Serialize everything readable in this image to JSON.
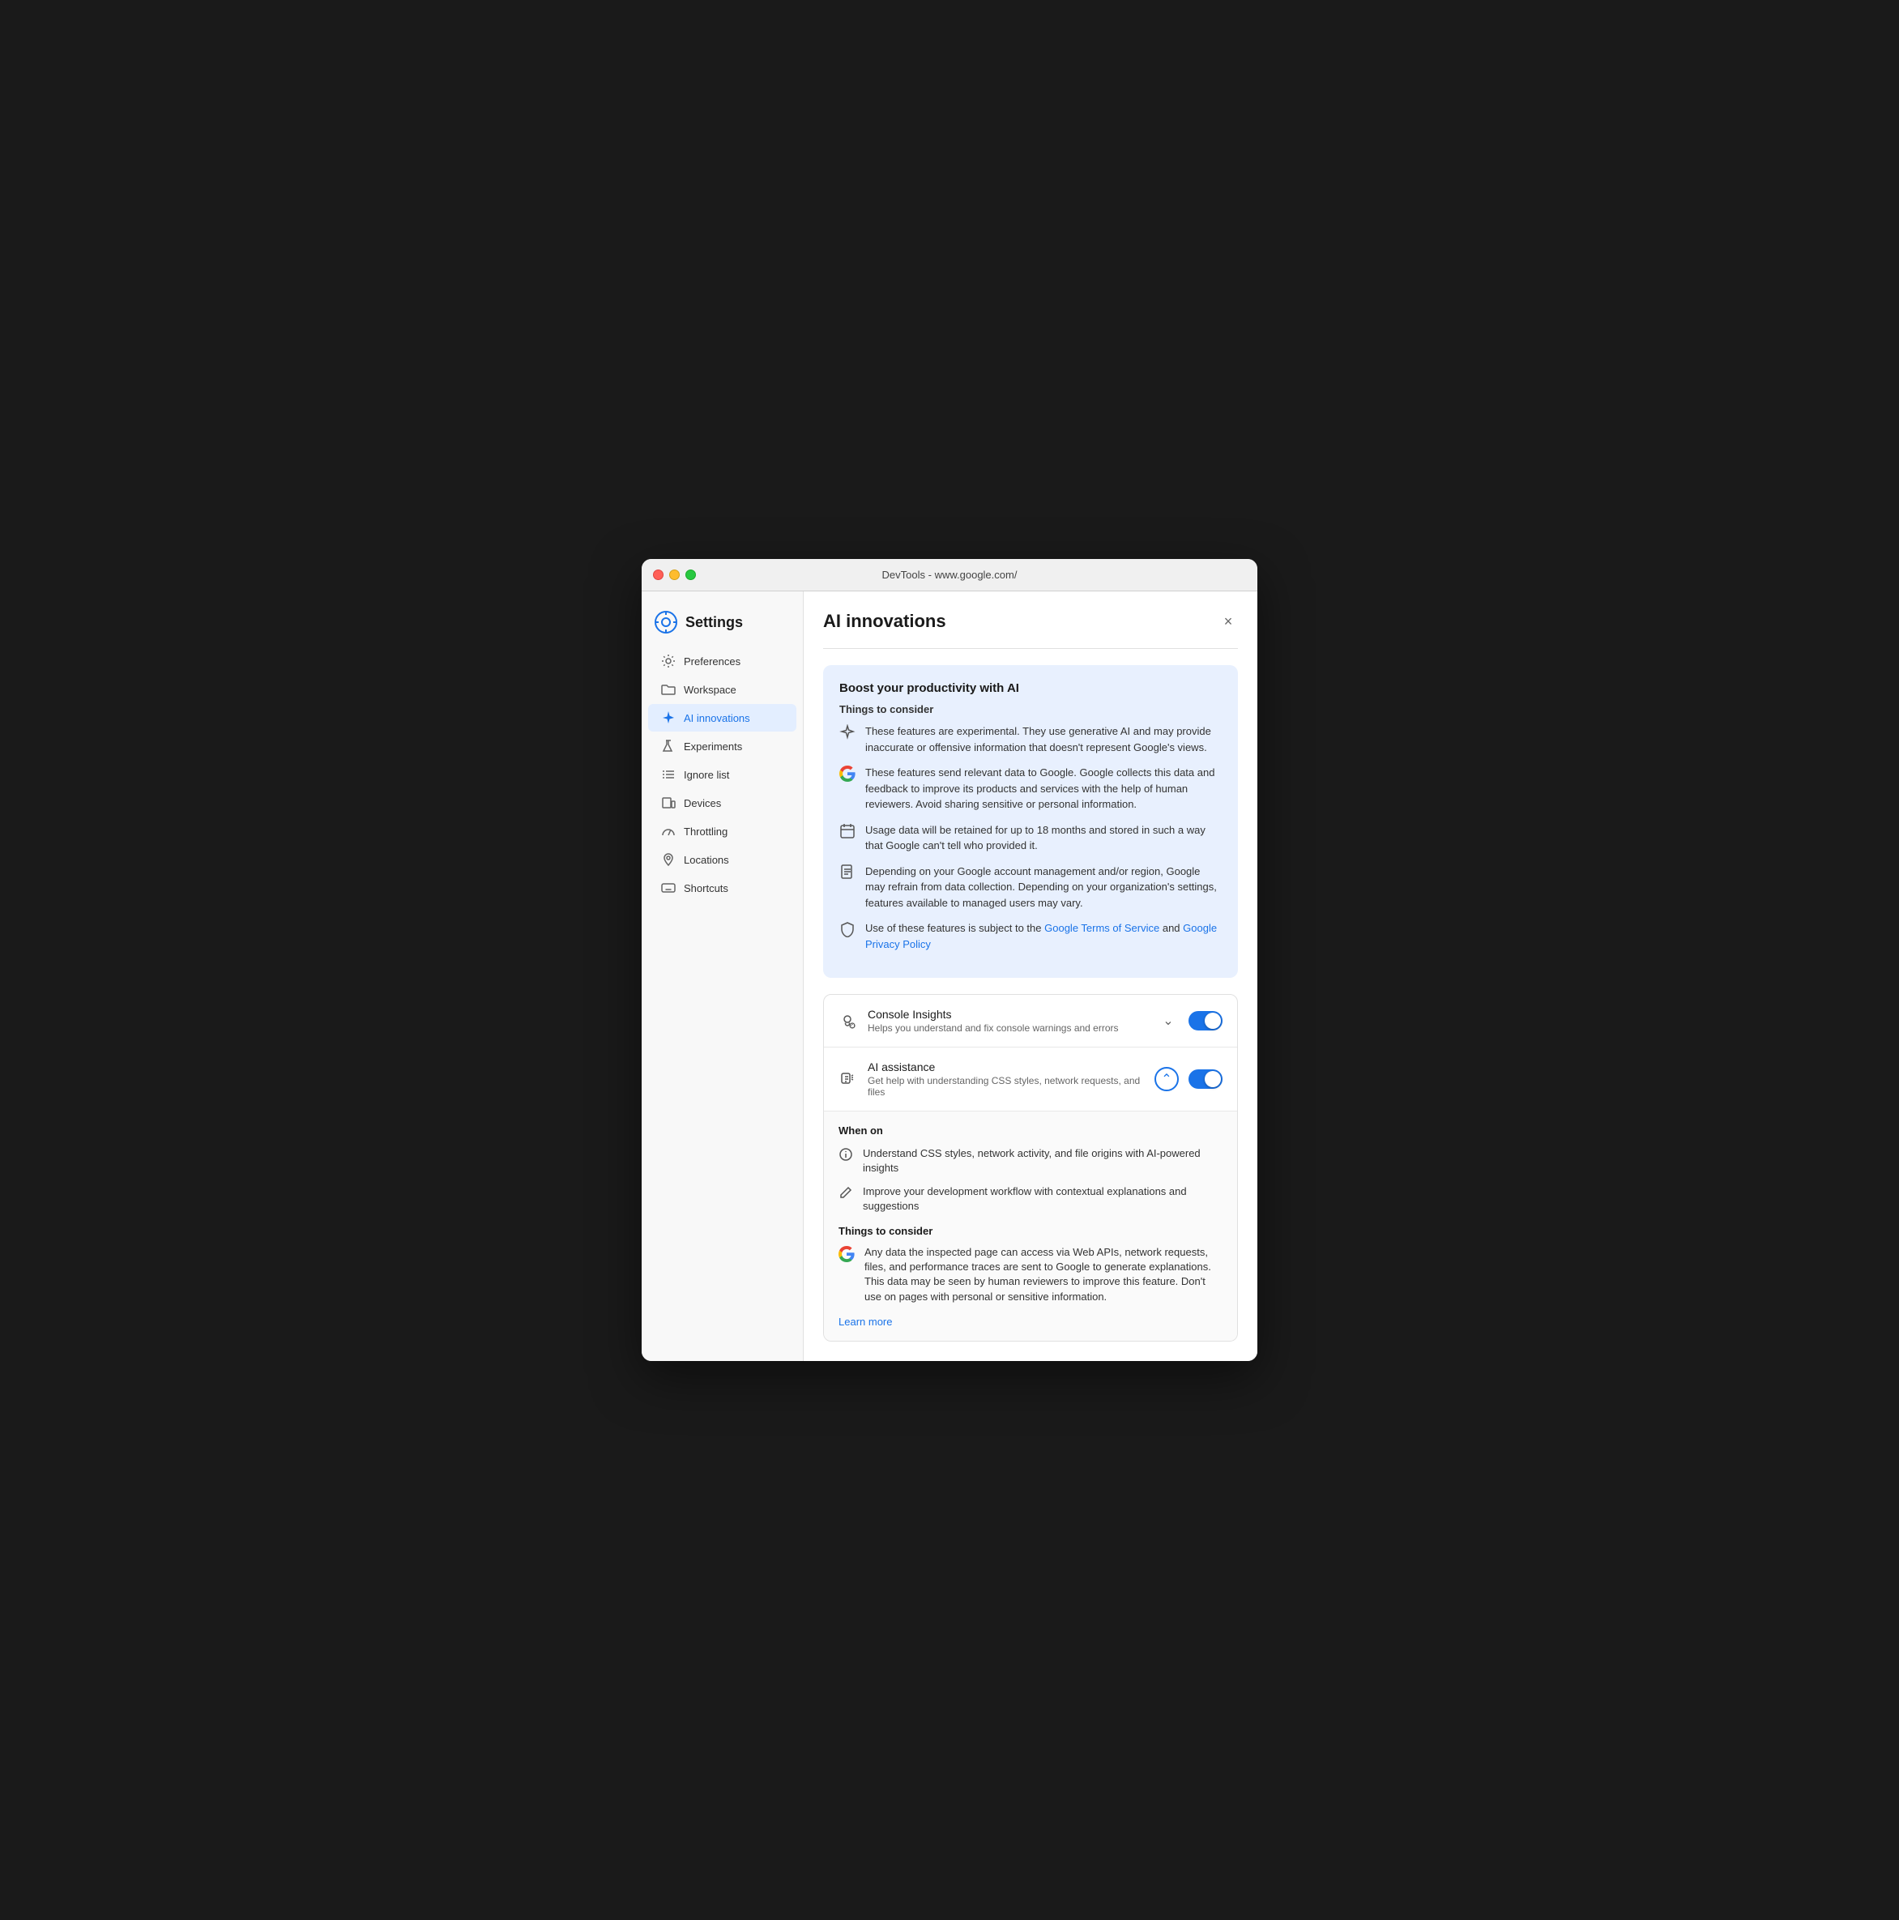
{
  "window": {
    "title": "DevTools - www.google.com/"
  },
  "sidebar": {
    "title": "Settings",
    "items": [
      {
        "id": "preferences",
        "label": "Preferences",
        "icon": "gear"
      },
      {
        "id": "workspace",
        "label": "Workspace",
        "icon": "folder"
      },
      {
        "id": "ai-innovations",
        "label": "AI innovations",
        "icon": "sparkle",
        "active": true
      },
      {
        "id": "experiments",
        "label": "Experiments",
        "icon": "flask"
      },
      {
        "id": "ignore-list",
        "label": "Ignore list",
        "icon": "list"
      },
      {
        "id": "devices",
        "label": "Devices",
        "icon": "device"
      },
      {
        "id": "throttling",
        "label": "Throttling",
        "icon": "gauge"
      },
      {
        "id": "locations",
        "label": "Locations",
        "icon": "pin"
      },
      {
        "id": "shortcuts",
        "label": "Shortcuts",
        "icon": "keyboard"
      }
    ]
  },
  "main": {
    "title": "AI innovations",
    "close_label": "×",
    "info_box": {
      "title": "Boost your productivity with AI",
      "subtitle": "Things to consider",
      "items": [
        {
          "icon": "sparkle-warn",
          "text": "These features are experimental. They use generative AI and may provide inaccurate or offensive information that doesn't represent Google's views."
        },
        {
          "icon": "google",
          "text": "These features send relevant data to Google. Google collects this data and feedback to improve its products and services with the help of human reviewers. Avoid sharing sensitive or personal information."
        },
        {
          "icon": "calendar",
          "text": "Usage data will be retained for up to 18 months and stored in such a way that Google can't tell who provided it."
        },
        {
          "icon": "document",
          "text": "Depending on your Google account management and/or region, Google may refrain from data collection. Depending on your organization's settings, features available to managed users may vary."
        },
        {
          "icon": "shield",
          "text_prefix": "Use of these features is subject to the ",
          "link1_text": "Google Terms of Service",
          "link1_href": "#",
          "text_mid": " and ",
          "link2_text": "Google Privacy Policy",
          "link2_href": "#",
          "text_suffix": ""
        }
      ]
    },
    "cards": [
      {
        "id": "console-insights",
        "icon": "lightbulb-gear",
        "title": "Console Insights",
        "desc": "Helps you understand and fix console warnings and errors",
        "expanded": false,
        "chevron": "down",
        "toggle_on": true
      },
      {
        "id": "ai-assistance",
        "icon": "ai-assist",
        "title": "AI assistance",
        "desc": "Get help with understanding CSS styles, network requests, and files",
        "expanded": true,
        "chevron": "up",
        "toggle_on": true,
        "when_on": {
          "title": "When on",
          "items": [
            {
              "icon": "info-circle",
              "text": "Understand CSS styles, network activity, and file origins with AI-powered insights"
            },
            {
              "icon": "pen",
              "text": "Improve your development workflow with contextual explanations and suggestions"
            }
          ]
        },
        "things_to_consider": {
          "title": "Things to consider",
          "items": [
            {
              "icon": "google",
              "text": "Any data the inspected page can access via Web APIs, network requests, files, and performance traces are sent to Google to generate explanations. This data may be seen by human reviewers to improve this feature. Don't use on pages with personal or sensitive information."
            }
          ]
        },
        "learn_more": "Learn more",
        "learn_more_href": "#"
      }
    ]
  }
}
